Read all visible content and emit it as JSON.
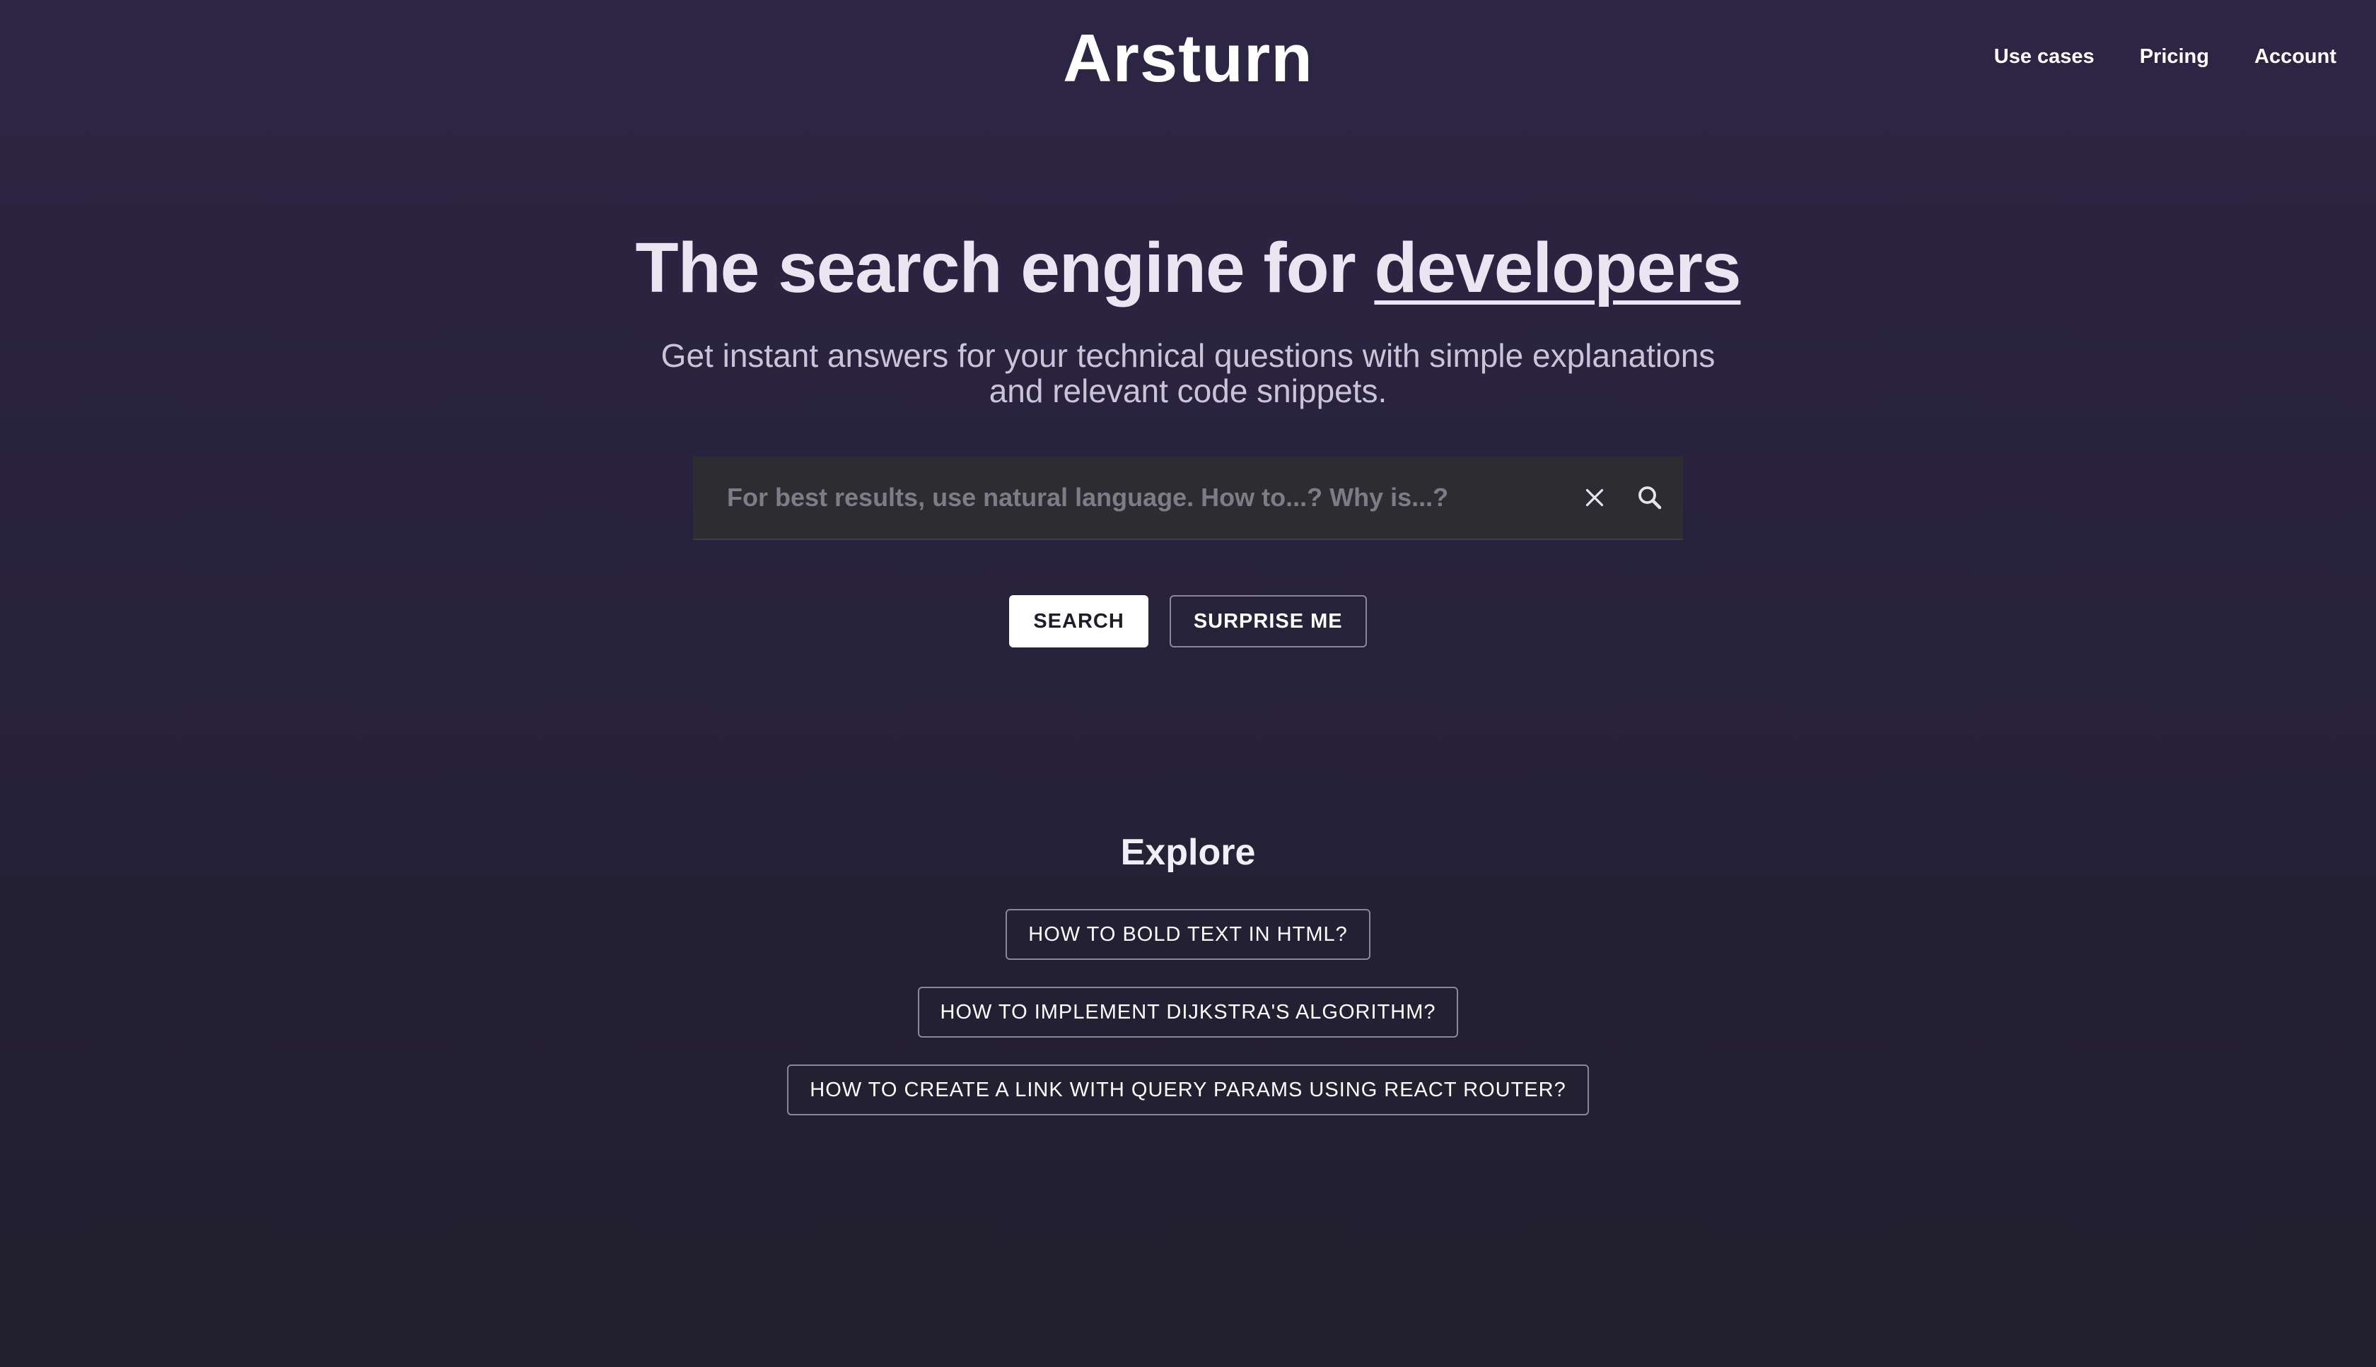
{
  "brand": {
    "logo_text": "Arsturn"
  },
  "nav": {
    "items": [
      {
        "label": "Use cases"
      },
      {
        "label": "Pricing"
      },
      {
        "label": "Account"
      }
    ]
  },
  "hero": {
    "headline_prefix": "The search engine for ",
    "headline_accent": "developers",
    "subtitle": "Get instant answers for your technical questions with simple explanations and relevant code snippets."
  },
  "search": {
    "placeholder": "For best results, use natural language. How to...? Why is...?",
    "value": "",
    "clear_icon": "close-icon",
    "search_icon": "search-icon"
  },
  "actions": {
    "search_label": "SEARCH",
    "surprise_label": "SURPRISE ME"
  },
  "explore": {
    "title": "Explore",
    "items": [
      {
        "label": "HOW TO BOLD TEXT IN HTML?"
      },
      {
        "label": "HOW TO IMPLEMENT DIJKSTRA'S ALGORITHM?"
      },
      {
        "label": "HOW TO CREATE A LINK WITH QUERY PARAMS USING REACT ROUTER?"
      }
    ]
  },
  "colors": {
    "background_top": "#2d2645",
    "background_bottom": "#211f2d",
    "search_bg": "#2d2c30",
    "primary_button_bg": "#ffffff"
  }
}
